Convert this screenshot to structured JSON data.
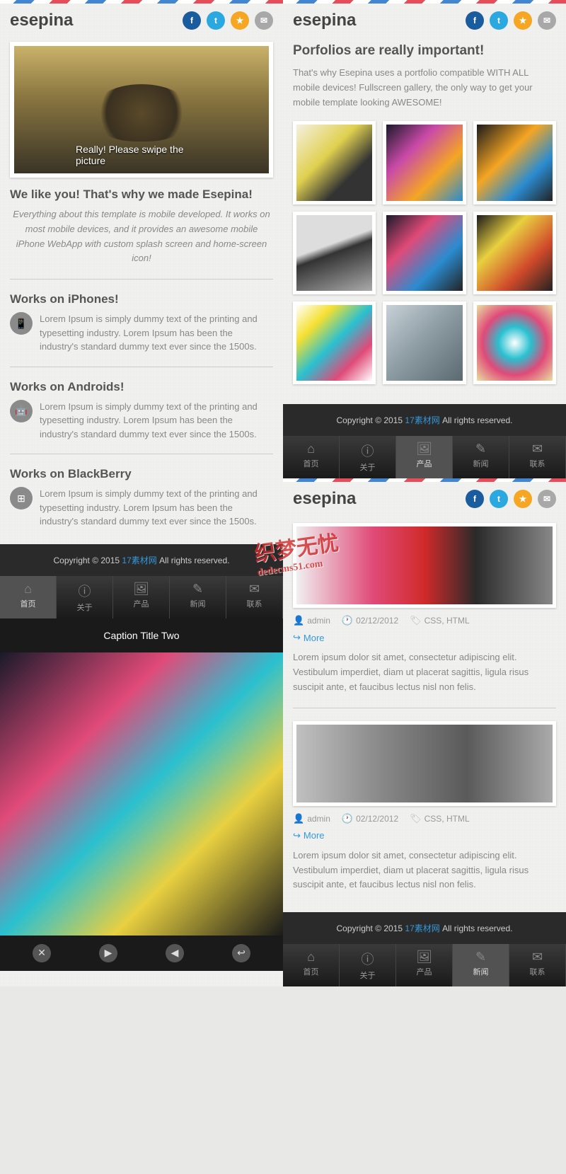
{
  "brand": "esepina",
  "social": {
    "fb": "f",
    "tw": "t",
    "rss": "★",
    "mail": "✉"
  },
  "panel1": {
    "hero_caption": "Really! Please swipe the picture",
    "heading": "We like you! That's why we made Esepina!",
    "intro": "Everything about this template is mobile developed. It works on most mobile devices, and it provides an awesome mobile iPhone WebApp with custom splash screen and home-screen icon!",
    "features": [
      {
        "title": "Works on iPhones!",
        "text": "Lorem Ipsum is simply dummy text of the printing and typesetting industry. Lorem Ipsum has been the industry's standard dummy text ever since the 1500s."
      },
      {
        "title": "Works on Androids!",
        "text": "Lorem Ipsum is simply dummy text of the printing and typesetting industry. Lorem Ipsum has been the industry's standard dummy text ever since the 1500s."
      },
      {
        "title": "Works on BlackBerry",
        "text": "Lorem Ipsum is simply dummy text of the printing and typesetting industry. Lorem Ipsum has been the industry's standard dummy text ever since the 1500s."
      }
    ]
  },
  "footer": {
    "copy_pre": "Copyright © 2015 ",
    "link": "17素材网",
    "copy_post": " All rights reserved."
  },
  "nav": [
    "首页",
    "关于",
    "产品",
    "新闻",
    "联系"
  ],
  "panel2": {
    "title": "Porfolios are really important!",
    "desc": "That's why Esepina uses a portfolio compatible WITH ALL mobile devices! Fullscreen gallery, the only way to get your mobile template looking AWESOME!"
  },
  "gallery": {
    "caption": "Caption Title Two"
  },
  "blog": {
    "posts": [
      {
        "author": "admin",
        "date": "02/12/2012",
        "tags": "CSS, HTML",
        "more": "More",
        "desc": "Lorem ipsum dolor sit amet, consectetur adipiscing elit. Vestibulum imperdiet, diam ut placerat sagittis, ligula risus suscipit ante, et faucibus lectus nisl non felis."
      },
      {
        "author": "admin",
        "date": "02/12/2012",
        "tags": "CSS, HTML",
        "more": "More",
        "desc": "Lorem ipsum dolor sit amet, consectetur adipiscing elit. Vestibulum imperdiet, diam ut placerat sagittis, ligula risus suscipit ante, et faucibus lectus nisl non felis."
      }
    ]
  },
  "watermark": {
    "text": "织梦无忧",
    "url": "dedecms51.com"
  }
}
